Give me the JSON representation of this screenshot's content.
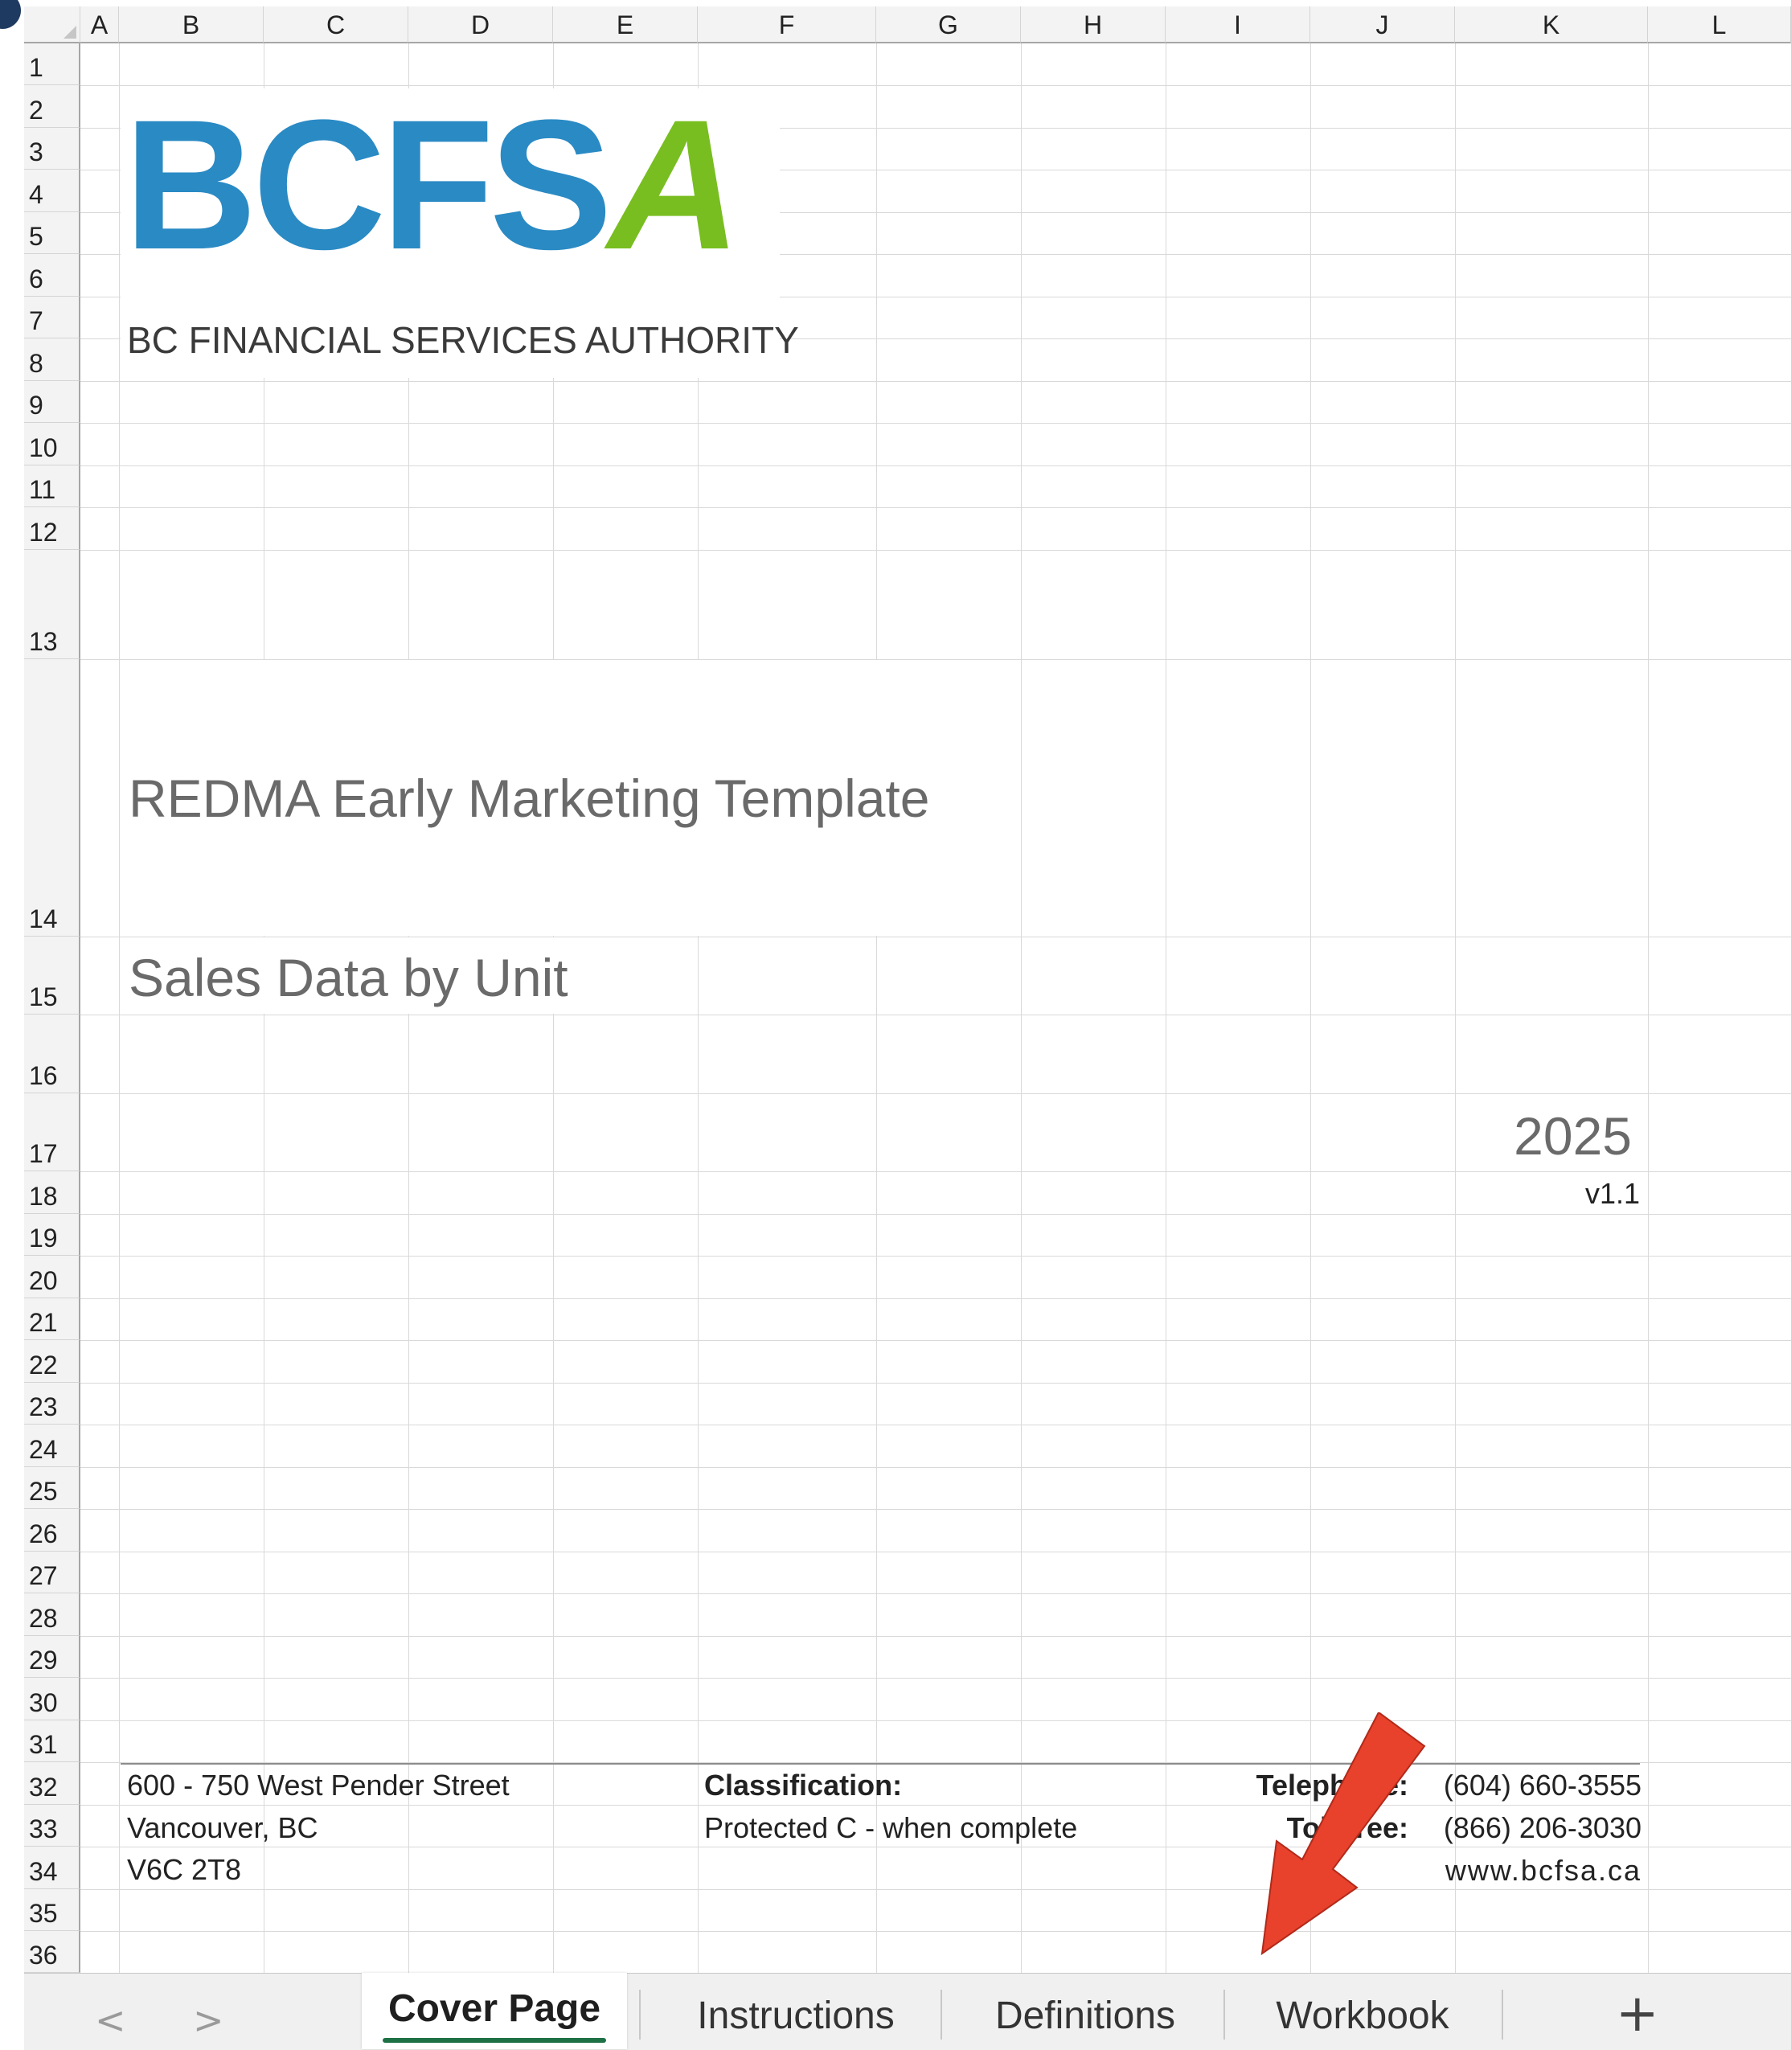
{
  "columns": [
    "A",
    "B",
    "C",
    "D",
    "E",
    "F",
    "G",
    "H",
    "I",
    "J",
    "K",
    "L"
  ],
  "rows": [
    "1",
    "2",
    "3",
    "4",
    "5",
    "6",
    "7",
    "8",
    "9",
    "10",
    "11",
    "12",
    "13",
    "14",
    "15",
    "16",
    "17",
    "18",
    "19",
    "20",
    "21",
    "22",
    "23",
    "24",
    "25",
    "26",
    "27",
    "28",
    "29",
    "30",
    "31",
    "32",
    "33",
    "34",
    "35",
    "36"
  ],
  "logo": {
    "letters_blue": "BCFS",
    "letter_green": "A",
    "subtitle": "BC FINANCIAL SERVICES AUTHORITY",
    "blue": "#2a8ac4",
    "green": "#78be20"
  },
  "cover": {
    "title": "REDMA Early Marketing Template",
    "subtitle": "Sales Data by Unit",
    "year": "2025",
    "version": "v1.1"
  },
  "footer": {
    "address_line1": "600 - 750 West Pender Street",
    "address_line2": "Vancouver, BC",
    "address_line3": "V6C 2T8",
    "classification_label": "Classification:",
    "classification_value": "Protected C - when complete",
    "telephone_label": "Telephone:",
    "telephone_value": "(604) 660-3555",
    "tollfree_label": "Toll-free:",
    "tollfree_value": "(866) 206-3030",
    "website": "www.bcfsa.ca"
  },
  "tabs": {
    "items": [
      "Cover Page",
      "Instructions",
      "Definitions",
      "Workbook"
    ],
    "active": "Cover Page",
    "prev_glyph": "<",
    "next_glyph": ">",
    "add_glyph": "+"
  },
  "annotation": {
    "arrow_color": "#e8412c"
  }
}
